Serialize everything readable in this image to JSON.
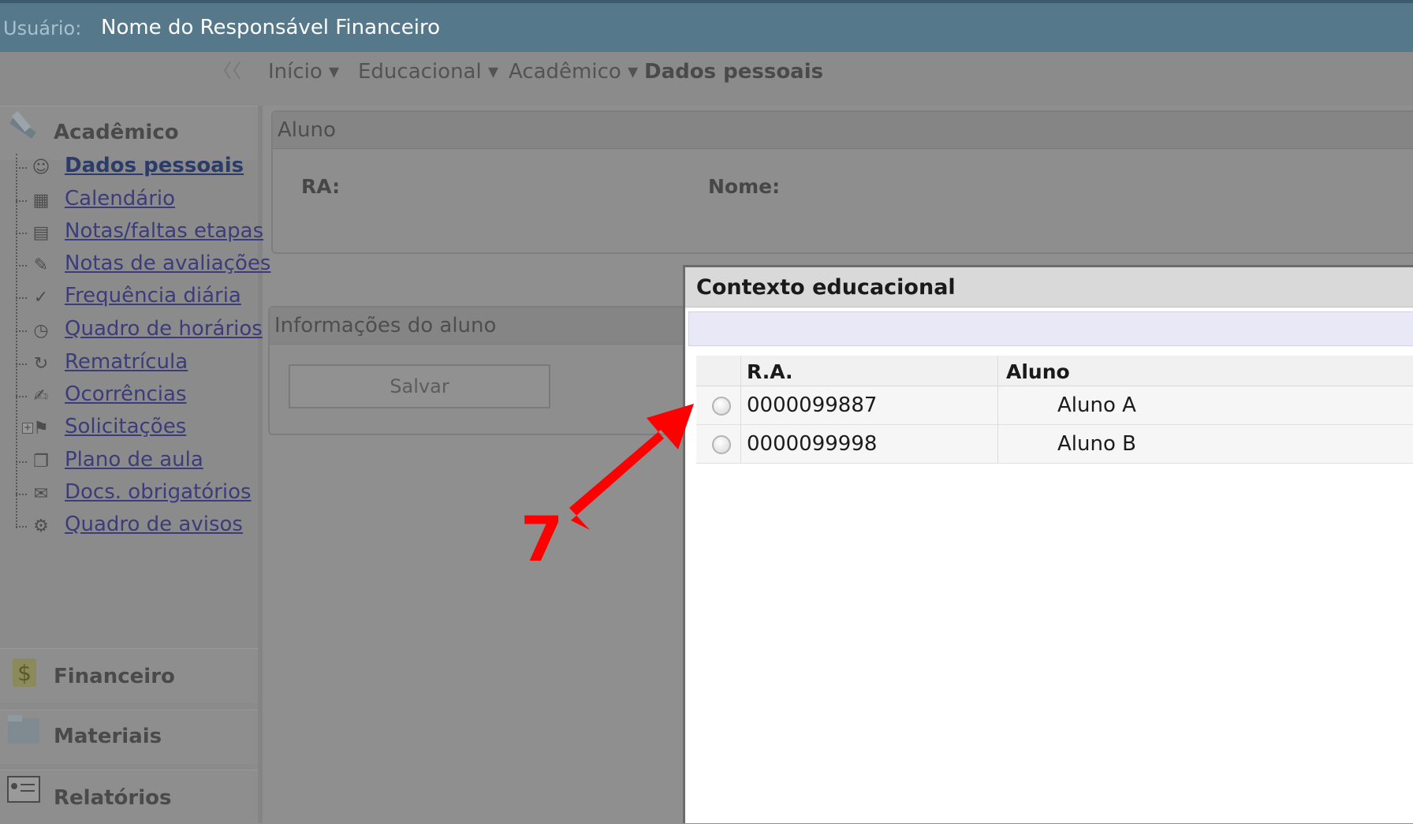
{
  "topbar": {
    "user_label": "Usuário:",
    "user_name": "Nome do Responsável Financeiro"
  },
  "collapse_icon": "double-chevron-left-icon",
  "breadcrumb": [
    {
      "label": "Início ▾"
    },
    {
      "label": "Educacional ▾"
    },
    {
      "label": "Acadêmico ▾"
    },
    {
      "label": "Dados pessoais"
    }
  ],
  "sidebar": {
    "academico": {
      "title": "Acadêmico",
      "items": [
        {
          "label": "Dados pessoais",
          "icon": "person-icon"
        },
        {
          "label": "Calendário",
          "icon": "calendar-icon"
        },
        {
          "label": "Notas/faltas etapas",
          "icon": "table-icon"
        },
        {
          "label": "Notas de avaliações",
          "icon": "grades-icon"
        },
        {
          "label": "Frequência diária",
          "icon": "attendance-icon"
        },
        {
          "label": "Quadro de horários",
          "icon": "clock-icon"
        },
        {
          "label": "Rematrícula",
          "icon": "reenroll-icon"
        },
        {
          "label": "Ocorrências",
          "icon": "occurrence-icon"
        },
        {
          "label": "Solicitações",
          "icon": "request-icon"
        },
        {
          "label": "Plano de aula",
          "icon": "book-icon"
        },
        {
          "label": "Docs. obrigatórios",
          "icon": "documents-icon"
        },
        {
          "label": "Quadro de avisos",
          "icon": "notice-board-icon"
        }
      ]
    },
    "financeiro": "Financeiro",
    "materiais": "Materiais",
    "relatorios": "Relatórios"
  },
  "aluno_panel": {
    "title": "Aluno",
    "ra_label": "RA:",
    "nome_label": "Nome:"
  },
  "info_panel": {
    "title": "Informações do aluno",
    "save_label": "Salvar"
  },
  "modal": {
    "title": "Contexto educacional",
    "columns": [
      "R.A.",
      "Aluno"
    ],
    "rows": [
      {
        "ra": "0000099887",
        "aluno": "Aluno A"
      },
      {
        "ra": "0000099998",
        "aluno": "Aluno B"
      }
    ]
  },
  "annotation": {
    "number": "7",
    "color": "#ff0000"
  }
}
